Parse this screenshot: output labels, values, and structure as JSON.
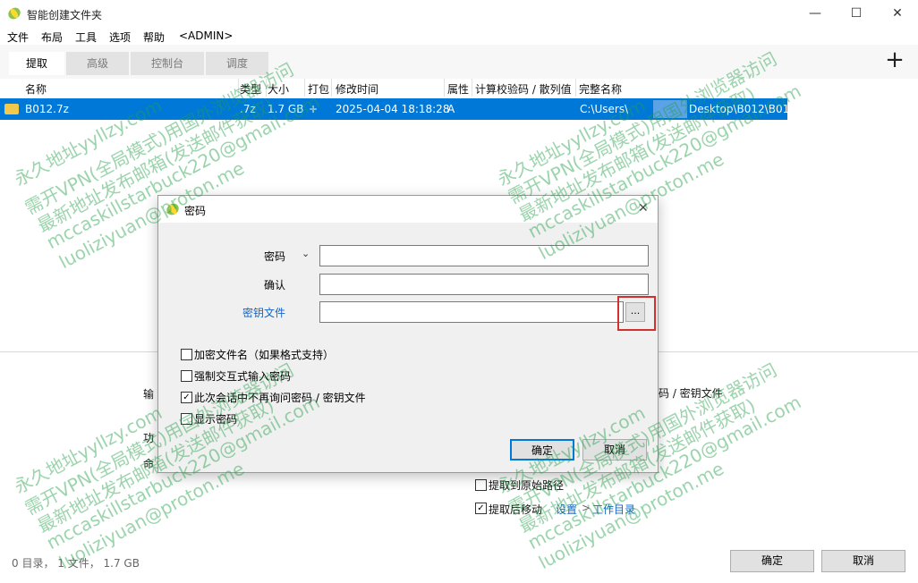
{
  "window": {
    "title": "智能创建文件夹",
    "minimize": "—",
    "maximize": "☐",
    "close": "✕"
  },
  "menu": [
    "文件",
    "布局",
    "工具",
    "选项",
    "帮助",
    "<ADMIN>"
  ],
  "tabs": [
    "提取",
    "高级",
    "控制台",
    "调度"
  ],
  "add_icon": "+",
  "columns": [
    "名称",
    "类型",
    "大小",
    "打包",
    "修改时间",
    "属性",
    "计算校验码 / 散列值",
    "完整名称"
  ],
  "row": {
    "name": "B012.7z",
    "type": ".7z",
    "size": "1.7 GB",
    "pack": "+",
    "modified": "2025-04-04 18:18:28",
    "attr": "A",
    "full_name_prefix": "C:\\Users\\",
    "full_name_suffix": "Desktop\\B012\\B012.7z"
  },
  "bottom": {
    "partial_left_1": "输",
    "partial_left_2": "功",
    "partial_left_3": "命",
    "partial_right": "码 / 密钥文件",
    "extract_original_path": "提取到原始路径",
    "move_after_extract": "提取后移动",
    "settings_link": "设置",
    "arrow": ">",
    "workdir_link": "工作目录",
    "ok": "确定",
    "cancel": "取消",
    "status": "0 目录， 1 文件， 1.7 GB"
  },
  "dialog": {
    "title": "密码",
    "close": "✕",
    "password_label": "密码",
    "confirm_label": "确认",
    "keyfile_label": "密钥文件",
    "browse": "...",
    "password_value": "",
    "confirm_value": "",
    "keyfile_value": "",
    "opt_encrypt_names": "加密文件名（如果格式支持）",
    "opt_force_interactive": "强制交互式输入密码",
    "opt_no_ask": "此次会话中不再询问密码 / 密钥文件",
    "opt_show_password": "显示密码",
    "ok": "确定",
    "cancel": "取消"
  },
  "watermark": {
    "line1": "永久地址yyllzy.com",
    "line2": "需开VPN(全局模式)用国外浏览器访问",
    "line3": "最新地址发布邮箱(发送邮件获取)",
    "line4": "mccaskillstarbuck220@gmail.com",
    "line5": "luoliziyuan@proton.me"
  },
  "colors": {
    "selection": "#0078d7",
    "link": "#1565c0",
    "highlight": "#d32f2f"
  }
}
